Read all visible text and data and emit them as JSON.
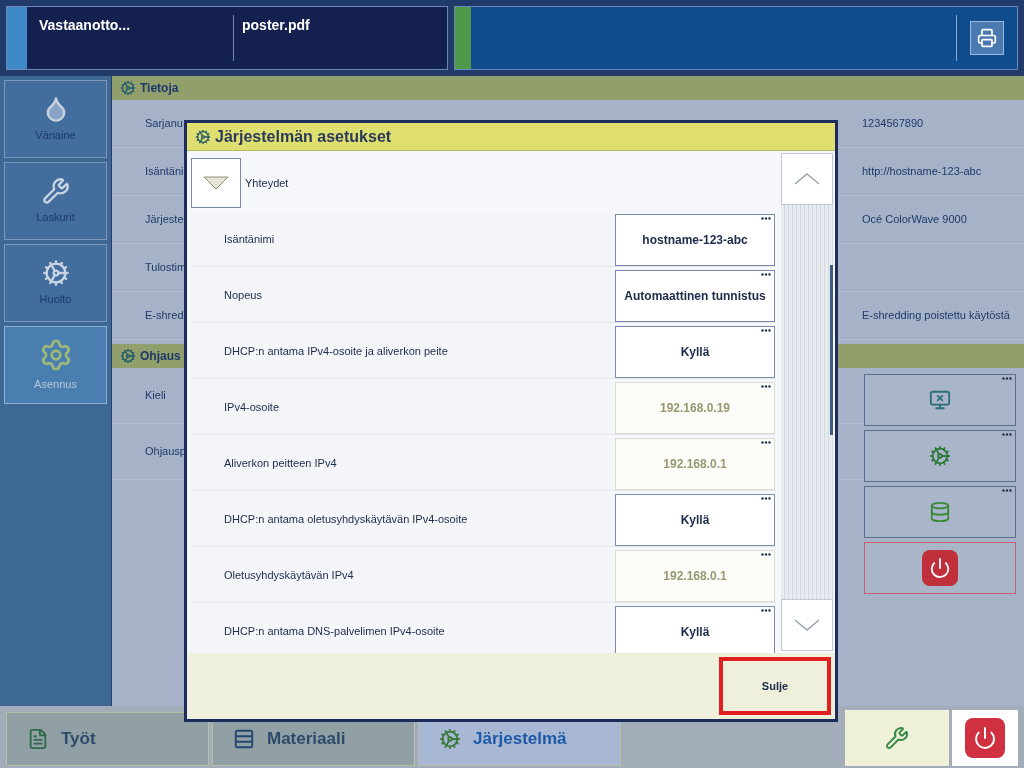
{
  "top_bar": {
    "job_panel": {
      "status": "Vastaanotto...",
      "file": "poster.pdf"
    }
  },
  "sidebar": {
    "items": [
      {
        "label": "Väriaine",
        "kind": "ink",
        "selected": false
      },
      {
        "label": "Laskurit",
        "kind": "counters",
        "selected": false
      },
      {
        "label": "Huolto",
        "kind": "maintenance",
        "selected": false
      },
      {
        "label": "Asennus",
        "kind": "setup",
        "selected": true
      }
    ]
  },
  "sections": [
    {
      "title": "Tietoja",
      "rows": [
        {
          "label": "Sarjanu",
          "value": "1234567890"
        },
        {
          "label": "Isäntäni",
          "value": "http://hostname-123-abc"
        },
        {
          "label": "Järjeste",
          "value": "Océ ColorWave 9000"
        },
        {
          "label": "Tulostim"
        },
        {
          "label": "E-shred",
          "value": "E-shredding poistettu käytöstä"
        }
      ]
    },
    {
      "title": "Ohjaus",
      "rows": [
        {
          "label": "Kieli"
        },
        {
          "label": "Ohjausp"
        }
      ],
      "buttons": [
        {
          "kind": "monitor-x"
        },
        {
          "kind": "gear"
        },
        {
          "kind": "database"
        },
        {
          "kind": "power"
        }
      ]
    }
  ],
  "dialog": {
    "title": "Järjestelmän asetukset",
    "group": {
      "label": "Yhteydet",
      "expanded": true
    },
    "rows": [
      {
        "label": "Isäntänimi",
        "value": "hostname-123-abc",
        "disabled": false
      },
      {
        "label": "Nopeus",
        "value": "Automaattinen tunnistus",
        "disabled": false
      },
      {
        "label": "DHCP:n antama IPv4-osoite ja aliverkon peite",
        "value": "Kyllä",
        "disabled": false
      },
      {
        "label": "IPv4-osoite",
        "value": "192.168.0.19",
        "disabled": true
      },
      {
        "label": "Aliverkon peitteen IPv4",
        "value": "192.168.0.1",
        "disabled": true
      },
      {
        "label": "DHCP:n antama oletusyhdyskäytävän IPv4-osoite",
        "value": "Kyllä",
        "disabled": false
      },
      {
        "label": "Oletusyhdyskäytävän IPv4",
        "value": "192.168.0.1",
        "disabled": true
      },
      {
        "label": "DHCP:n antama DNS-palvelimen IPv4-osoite",
        "value": "Kyllä",
        "disabled": false
      }
    ],
    "close_button": "Sulje"
  },
  "bottom_tabs": [
    {
      "label": "Työt",
      "kind": "jobs",
      "selected": false
    },
    {
      "label": "Materiaali",
      "kind": "media",
      "selected": false
    },
    {
      "label": "Järjestelmä",
      "kind": "system",
      "selected": true
    }
  ]
}
